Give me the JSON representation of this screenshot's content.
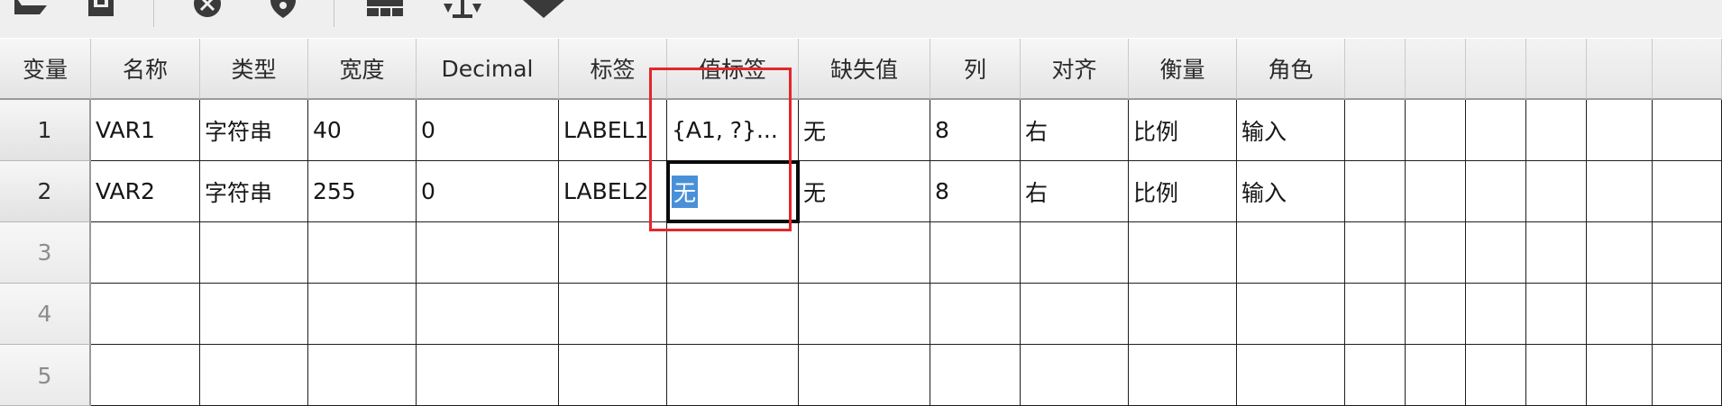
{
  "toolbar": {
    "icons": [
      "open-folder-icon",
      "save-icon",
      "delete-icon",
      "marker-icon",
      "table-icon",
      "balance-icon",
      "diamond-icon"
    ]
  },
  "grid": {
    "columns": [
      "变量",
      "名称",
      "类型",
      "宽度",
      "Decimal",
      "标签",
      "值标签",
      "缺失值",
      "列",
      "对齐",
      "衡量",
      "角色"
    ],
    "rows": [
      {
        "num": "1",
        "cells": [
          "VAR1",
          "字符串",
          "40",
          "0",
          "LABEL1",
          "{A1, ?}...",
          "无",
          "8",
          "右",
          "比例",
          "输入"
        ]
      },
      {
        "num": "2",
        "cells": [
          "VAR2",
          "字符串",
          "255",
          "0",
          "LABEL2",
          "无",
          "无",
          "8",
          "右",
          "比例",
          "输入"
        ]
      },
      {
        "num": "3",
        "cells": [
          "",
          "",
          "",
          "",
          "",
          "",
          "",
          "",
          "",
          "",
          ""
        ]
      },
      {
        "num": "4",
        "cells": [
          "",
          "",
          "",
          "",
          "",
          "",
          "",
          "",
          "",
          "",
          ""
        ]
      },
      {
        "num": "5",
        "cells": [
          "",
          "",
          "",
          "",
          "",
          "",
          "",
          "",
          "",
          "",
          ""
        ]
      }
    ]
  },
  "colors": {
    "selection": "#4a90d9",
    "annotation": "#e3262b"
  }
}
